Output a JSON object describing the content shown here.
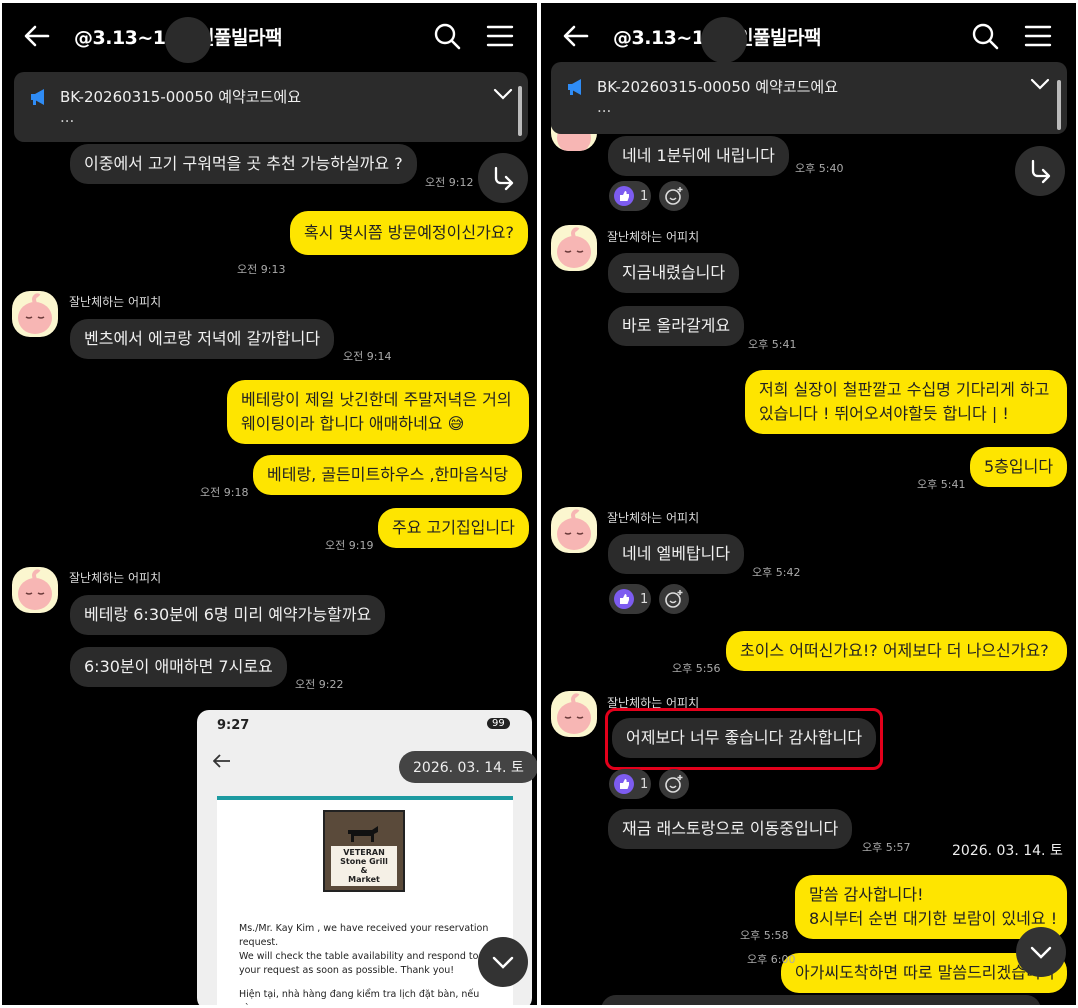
{
  "chat_title": "@3.13~15       3인풀빌라팩",
  "notice": {
    "text": "BK-20260315-00050 예약코드에요",
    "detail": "..."
  },
  "sender_name": "잘난체하는 어피치",
  "reaction_count": "1",
  "date_pill": "2026. 03. 14. 토",
  "left": {
    "messages": [
      {
        "text": "이중에서 고기 구워먹을 곳 추천 가능하실까요 ?",
        "time": "오전 9:12"
      },
      {
        "text": "혹시 몇시쯤 방문예정이신가요?",
        "time": "오전 9:13"
      },
      {
        "text": "벤츠에서 에코랑 저녁에 갈까합니다",
        "time": "오전 9:14"
      },
      {
        "text": "베테랑이 제일 낫긴한데 주말저녁은 거의",
        "text2": "웨이팅이라 합니다 애매하네요 😅"
      },
      {
        "text": "베테랑,  골든미트하우스 ,한마음식당",
        "time": "오전 9:18"
      },
      {
        "text": "주요 고기집입니다",
        "time": "오전 9:19"
      },
      {
        "text": "베테랑 6:30분에 6명 미리 예약가능할까요"
      },
      {
        "text": "6:30분이 애매하면 7시로요",
        "time": "오전 9:22"
      }
    ],
    "screenshot": {
      "status_time": "9:27",
      "battery": "99",
      "logo_lines": [
        "VETERAN",
        "Stone Grill",
        "&",
        "Market"
      ],
      "email_lines": [
        "Ms./Mr. Kay Kim , we have received your reservation request.",
        "We will check the table availability and respond to your request as soon as possible. Thank you!",
        "Hiện tại, nhà hàng đang kiểm tra lịch đặt bàn, nếu còn"
      ]
    }
  },
  "right": {
    "messages": [
      {
        "text": "네네 1분뒤에 내립니다",
        "time": "오후 5:40"
      },
      {
        "text": "지금내렸습니다"
      },
      {
        "text": "바로 올라갈게요",
        "time": "오후 5:41"
      },
      {
        "text": "저희 실장이 철판깔고 수십명 기다리게 하고",
        "text2": "있습니다 ! 뛰어오셔야할듯 합니다 | !"
      },
      {
        "text": "5층입니다",
        "time": "오후 5:41"
      },
      {
        "text": "네네 엘베탑니다",
        "time": "오후 5:42"
      },
      {
        "text": "초이스 어떠신가요!?  어제보다 더 나으신가요?",
        "time": "오후 5:56"
      },
      {
        "text": "어제보다 너무 좋습니다 감사합니다"
      },
      {
        "text": "재금 래스토랑으로 이동중입니다",
        "time": "오후 5:57"
      },
      {
        "text": "말씀 감사합니다!",
        "text2": "8시부터 순번 대기한 보람이 있네요 !",
        "time": "오후 5:58"
      },
      {
        "text": "아가씨도착하면 따로 말씀드리겠습니다",
        "time": "오후 6:00"
      }
    ]
  },
  "colors": {
    "outgoing": "#fee500",
    "incoming": "#2b2b2b",
    "highlight": "#e3001b",
    "reaction": "#7d5cf0"
  },
  "icons": [
    "back-arrow-icon",
    "search-icon",
    "menu-icon",
    "megaphone-icon",
    "chevron-down-icon",
    "share-icon",
    "scroll-down-icon",
    "heart-icon",
    "add-reaction-icon",
    "apeach-avatar"
  ]
}
